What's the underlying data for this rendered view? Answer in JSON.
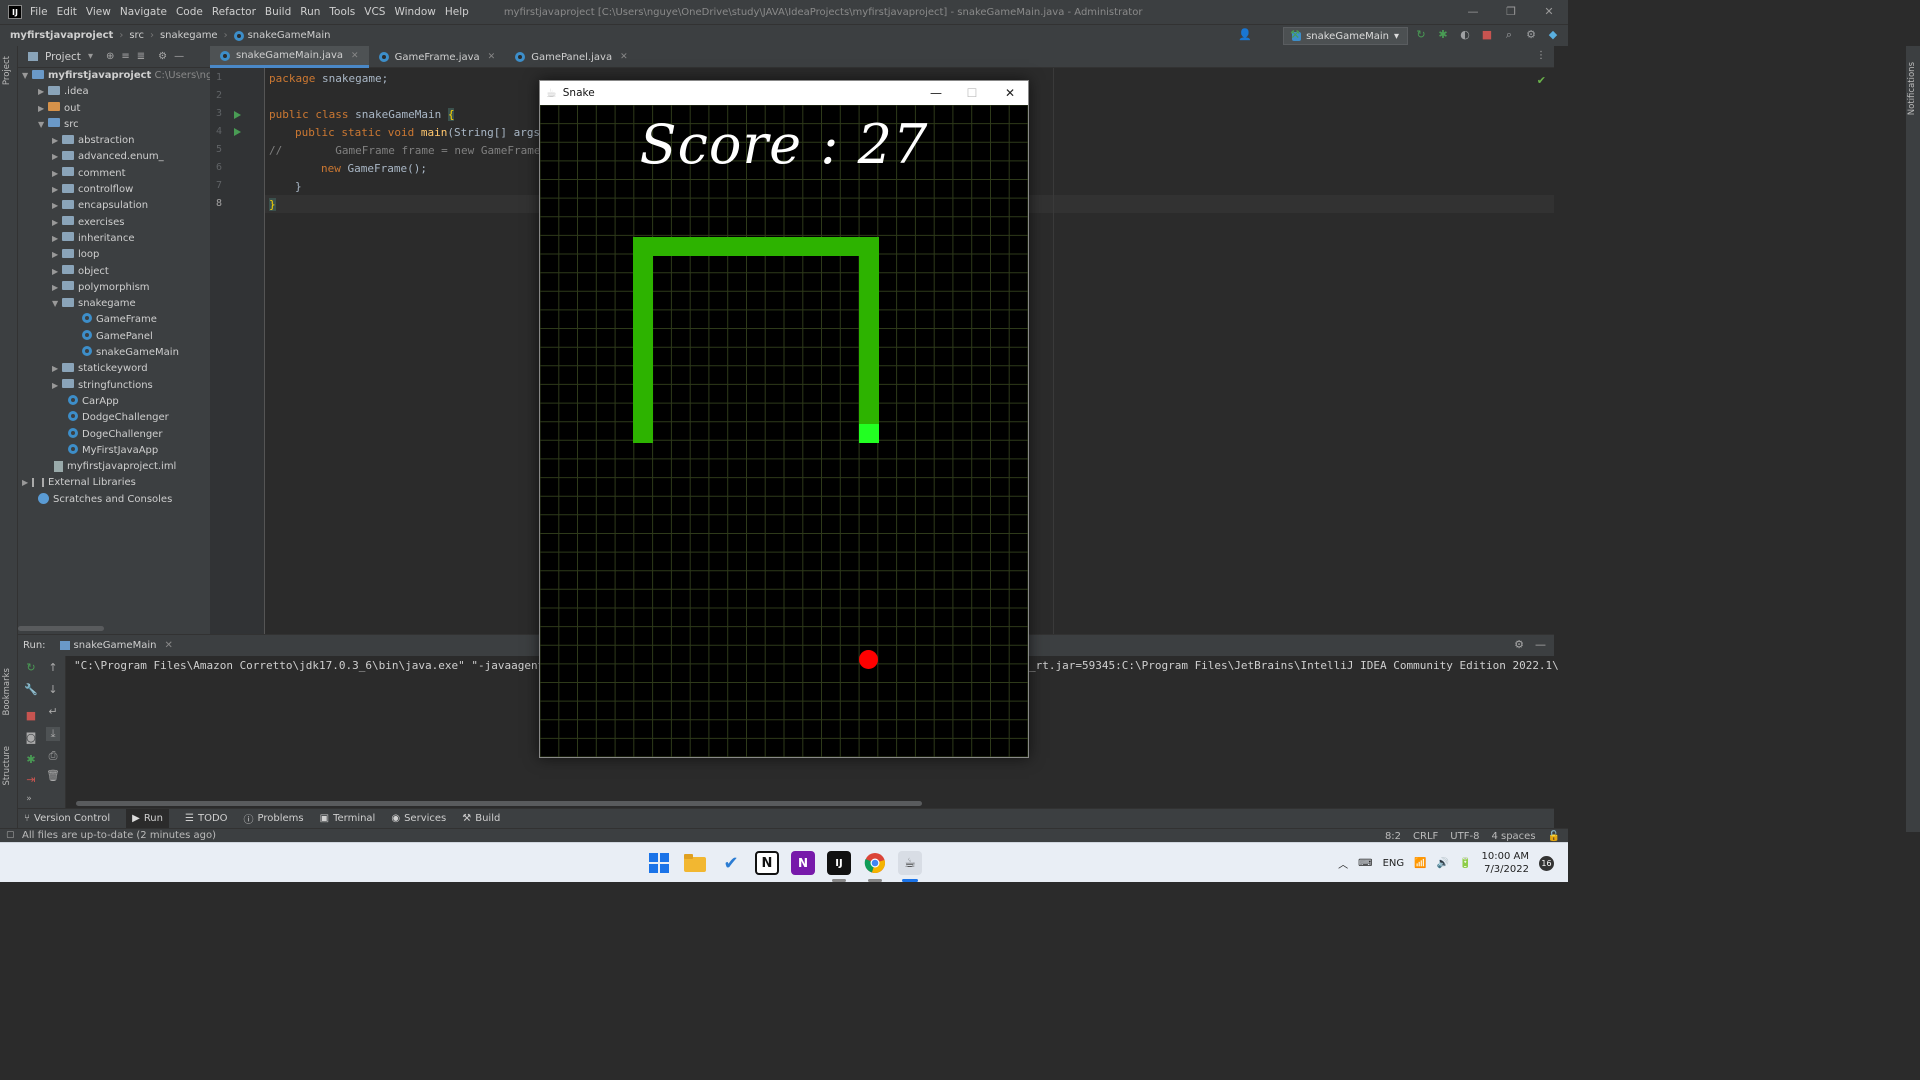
{
  "ide": {
    "logo": "IJ",
    "menu": [
      "File",
      "Edit",
      "View",
      "Navigate",
      "Code",
      "Refactor",
      "Build",
      "Run",
      "Tools",
      "VCS",
      "Window",
      "Help"
    ],
    "window_title": "myfirstjavaproject [C:\\Users\\nguye\\OneDrive\\study\\JAVA\\IdeaProjects\\myfirstjavaproject] - snakeGameMain.java - Administrator",
    "breadcrumb": [
      "myfirstjavaproject",
      "src",
      "snakegame",
      "snakeGameMain"
    ],
    "run_config": "snakeGameMain",
    "project_panel": {
      "title": "Project",
      "root": "myfirstjavaproject",
      "root_path": "C:\\Users\\nguye\\",
      "items": [
        ".idea",
        "out",
        "src",
        "abstraction",
        "advanced.enum_",
        "comment",
        "controlflow",
        "encapsulation",
        "exercises",
        "inheritance",
        "loop",
        "object",
        "polymorphism",
        "snakegame",
        "GameFrame",
        "GamePanel",
        "snakeGameMain",
        "statickeyword",
        "stringfunctions",
        "CarApp",
        "DodgeChallenger",
        "DogeChallenger",
        "MyFirstJavaApp",
        "myfirstjavaproject.iml",
        "External Libraries",
        "Scratches and Consoles"
      ]
    },
    "left_strip": {
      "project": "Project",
      "bookmarks": "Bookmarks",
      "structure": "Structure"
    },
    "right_strip": "Notifications",
    "editor_tabs": [
      "snakeGameMain.java",
      "GameFrame.java",
      "GamePanel.java"
    ],
    "line_numbers": [
      "1",
      "2",
      "3",
      "4",
      "5",
      "6",
      "7",
      "8"
    ],
    "code": {
      "l1_kw": "package",
      "l1_rest": " snakegame;",
      "l3_kw": "public class",
      "l3_name": " snakeGameMain ",
      "l3_brace": "{",
      "l4_kw": "public static void",
      "l4_fn": " main",
      "l4_rest": "(String[] args",
      "l5": "//        GameFrame frame = new GameFrame",
      "l6_kw": "new",
      "l6_rest": " GameFrame();",
      "l7": "}",
      "l8": "}"
    },
    "run_panel": {
      "label": "Run:",
      "tab": "snakeGameMain",
      "command_left": "\"C:\\Program Files\\Amazon Corretto\\jdk17.0.3_6\\bin\\java.exe\" \"-javaagent",
      "command_right": "_rt.jar=59345:C:\\Program Files\\JetBrains\\IntelliJ IDEA Community Edition 2022.1\\"
    },
    "tool_windows": [
      "Version Control",
      "Run",
      "TODO",
      "Problems",
      "Terminal",
      "Services",
      "Build"
    ],
    "status_message": "All files are up-to-date (2 minutes ago)",
    "status_right": [
      "8:2",
      "CRLF",
      "UTF-8",
      "4 spaces"
    ]
  },
  "snake_window": {
    "title": "Snake",
    "score_text": "Score : 27",
    "grid_cell_count": {
      "cols": 26,
      "rows": 35
    },
    "snake_color": "#2db300",
    "head_color": "#22ff22",
    "apple_color": "#ff0000"
  },
  "taskbar": {
    "lang": "ENG",
    "time": "10:00 AM",
    "date": "7/3/2022",
    "notification_count": "16"
  }
}
